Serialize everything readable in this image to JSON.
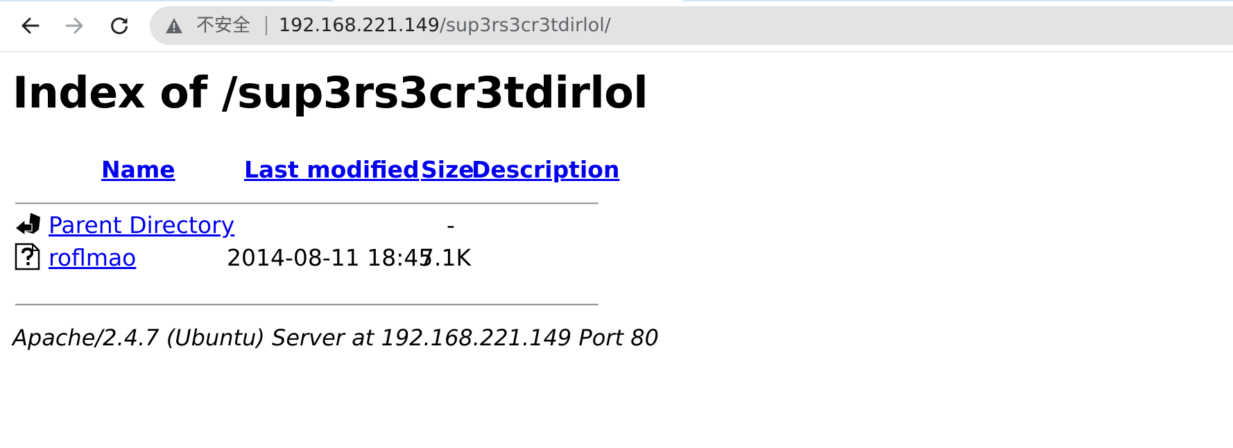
{
  "browser": {
    "security_label": "不安全",
    "url_host": "192.168.221.149",
    "url_path": "/sup3rs3cr3tdirlol/",
    "icons": {
      "back": "arrow-left-icon",
      "forward": "arrow-right-icon",
      "reload": "reload-icon",
      "security": "warning-triangle-icon"
    }
  },
  "page": {
    "title": "Index of /sup3rs3cr3tdirlol",
    "columns": {
      "name": "Name",
      "last_modified": "Last modified",
      "size": "Size",
      "description": "Description"
    },
    "rows": [
      {
        "icon": "back-folder-icon",
        "name": "Parent Directory",
        "last_modified": "",
        "size": "-",
        "description": ""
      },
      {
        "icon": "unknown-file-icon",
        "name": "roflmao",
        "last_modified": "2014-08-11 18:45",
        "size": "7.1K",
        "description": ""
      }
    ],
    "footer": "Apache/2.4.7 (Ubuntu) Server at 192.168.221.149 Port 80"
  },
  "colors": {
    "link": "#0000ee",
    "omnibox_bg": "#e3e3e3",
    "rule": "#9a9a9a"
  }
}
